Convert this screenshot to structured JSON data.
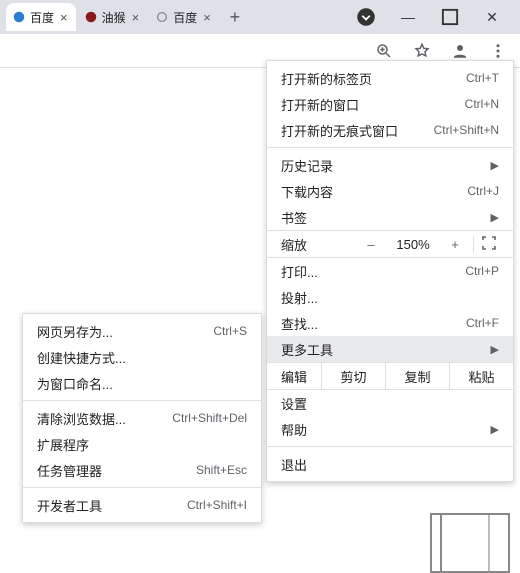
{
  "tabs": [
    {
      "title": "百度",
      "favicon_color": "#2b7cd3"
    },
    {
      "title": "油猴",
      "favicon_color": "#8b1a1a"
    },
    {
      "title": "百度",
      "favicon_color": "#888"
    }
  ],
  "window_controls": {
    "chevron": "▾",
    "min": "—",
    "max": "▢",
    "close": "✕"
  },
  "main_menu": {
    "new_tab": {
      "label": "打开新的标签页",
      "shortcut": "Ctrl+T"
    },
    "new_window": {
      "label": "打开新的窗口",
      "shortcut": "Ctrl+N"
    },
    "new_incognito": {
      "label": "打开新的无痕式窗口",
      "shortcut": "Ctrl+Shift+N"
    },
    "history": {
      "label": "历史记录"
    },
    "downloads": {
      "label": "下载内容",
      "shortcut": "Ctrl+J"
    },
    "bookmarks": {
      "label": "书签"
    },
    "zoom": {
      "label": "缩放",
      "minus": "–",
      "value": "150%",
      "plus": "+"
    },
    "print": {
      "label": "打印...",
      "shortcut": "Ctrl+P"
    },
    "cast": {
      "label": "投射..."
    },
    "find": {
      "label": "查找...",
      "shortcut": "Ctrl+F"
    },
    "more_tools": {
      "label": "更多工具"
    },
    "edit": {
      "label": "编辑",
      "cut": "剪切",
      "copy": "复制",
      "paste": "粘贴"
    },
    "settings": {
      "label": "设置"
    },
    "help": {
      "label": "帮助"
    },
    "exit": {
      "label": "退出"
    }
  },
  "sub_menu": {
    "save_as": {
      "label": "网页另存为...",
      "shortcut": "Ctrl+S"
    },
    "create_shortcut": {
      "label": "创建快捷方式..."
    },
    "name_window": {
      "label": "为窗口命名..."
    },
    "clear_data": {
      "label": "清除浏览数据...",
      "shortcut": "Ctrl+Shift+Del"
    },
    "extensions": {
      "label": "扩展程序"
    },
    "task_manager": {
      "label": "任务管理器",
      "shortcut": "Shift+Esc"
    },
    "dev_tools": {
      "label": "开发者工具",
      "shortcut": "Ctrl+Shift+I"
    }
  }
}
